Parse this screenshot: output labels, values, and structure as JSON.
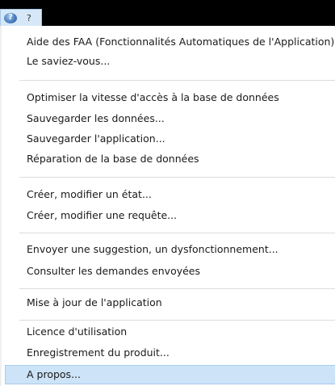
{
  "menubar": {
    "help_icon": "help-question-icon",
    "help_label": "?"
  },
  "menu": {
    "items": [
      {
        "label": "Aide des FAA (Fonctionnalités Automatiques de l'Application)"
      },
      {
        "label": "Le saviez-vous..."
      },
      {
        "label": "Optimiser la vitesse d'accès à la base de données"
      },
      {
        "label": "Sauvegarder les données..."
      },
      {
        "label": "Sauvegarder l'application..."
      },
      {
        "label": "Réparation de la base de données"
      },
      {
        "label": "Créer, modifier un état..."
      },
      {
        "label": "Créer, modifier une requête..."
      },
      {
        "label": "Envoyer une suggestion, un dysfonctionnement..."
      },
      {
        "label": "Consulter les demandes envoyées"
      },
      {
        "label": "Mise à jour de l'application"
      },
      {
        "label": "Licence d'utilisation"
      },
      {
        "label": "Enregistrement du produit..."
      },
      {
        "label": "A propos...",
        "selected": true
      }
    ]
  },
  "colors": {
    "topbar": "#000000",
    "selected_background": "#cde3f7",
    "selected_border": "#a7cbee"
  }
}
